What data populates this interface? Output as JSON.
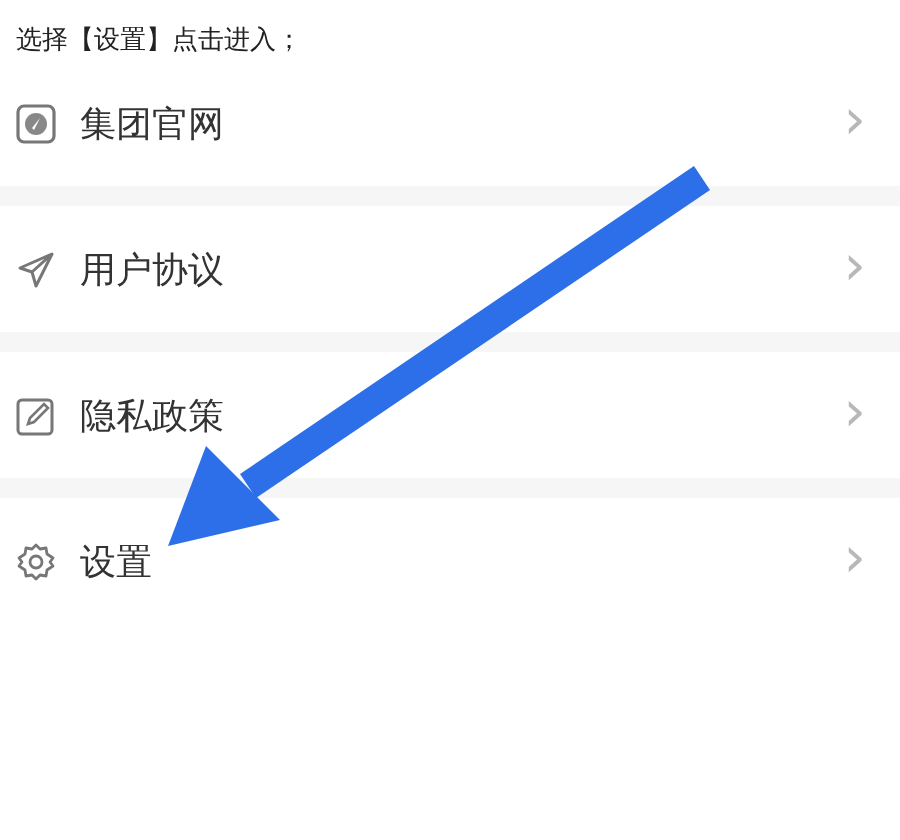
{
  "caption": "选择【设置】点击进入；",
  "menu": [
    {
      "kind": "site",
      "label": "集团官网",
      "chevron": "›"
    },
    {
      "kind": "agreement",
      "label": "用户协议",
      "chevron": "›"
    },
    {
      "kind": "privacy",
      "label": "隐私政策",
      "chevron": "›"
    },
    {
      "kind": "settings",
      "label": "设置",
      "chevron": "›"
    }
  ]
}
